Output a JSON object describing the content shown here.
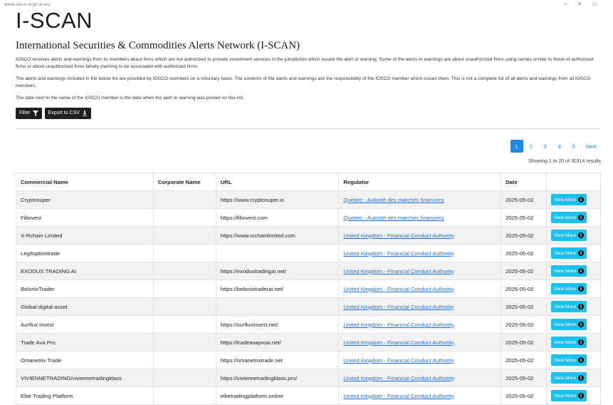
{
  "browser": {
    "url": "www.iosco.org/i-scan/"
  },
  "header": {
    "brand": "I-SCAN",
    "subtitle": "International Securities & Commodities Alerts Network (I-SCAN)"
  },
  "intro": {
    "p1": "IOSCO receives alerts and warnings from its members about firms which are not authorized to provide investment services in the jurisdiction which issued the alert or warning. Some of the alerts or warnings are about unauthorized firms using names similar to those of authorized firms or about unauthorized firms falsely claiming to be associated with authorized firms.",
    "p2": "The alerts and warnings included in the below list are provided by IOSCO members on a voluntary basis. The contents of the alerts and warnings are the responsibility of the IOSCO member which issues them. This is not a complete list of all alerts and warnings from all IOSCO members.",
    "p3": "The date next to the name of the IOSCO member is the date when the alert or warning was posted on this list."
  },
  "toolbar": {
    "filter_label": "Filter",
    "filter_icon": "funnel-icon",
    "export_label": "Export to CSV",
    "export_icon": "download-icon"
  },
  "pagination": {
    "pages": [
      "1",
      "2",
      "3",
      "4",
      "5"
    ],
    "active": "1",
    "next_label": "Next",
    "results_text": "Showing 1 to 20 of 30314 results"
  },
  "table": {
    "headers": [
      "Commercial Name",
      "Corporate Name",
      "URL",
      "Regulator",
      "Date",
      ""
    ],
    "view_more_label": "View More",
    "rows": [
      {
        "name": "Cryptosuper",
        "corp": "",
        "url": "https://www.cryptosuper.io",
        "regulator": "Quebec - Autorité des marchés financiers",
        "date": "2025-05-02"
      },
      {
        "name": "Fibovest",
        "corp": "",
        "url": "https://fibovest.com",
        "regulator": "Quebec - Autorité des marchés financiers",
        "date": "2025-05-02"
      },
      {
        "name": "X-Rchain Limited",
        "corp": "",
        "url": "https://www.xrchainlimited.com",
        "regulator": "United Kingdom - Financial Conduct Authority",
        "date": "2025-05-02"
      },
      {
        "name": "Legitoptiontrade",
        "corp": "",
        "url": "",
        "regulator": "United Kingdom - Financial Conduct Authority",
        "date": "2025-05-02"
      },
      {
        "name": "EXODUS TRADING AI",
        "corp": "",
        "url": "https://exodustradingai.net/",
        "regulator": "United Kingdom - Financial Conduct Authority",
        "date": "2025-05-02"
      },
      {
        "name": "BelonixTrader",
        "corp": "",
        "url": "https://belonixtraderai.net/",
        "regulator": "United Kingdom - Financial Conduct Authority",
        "date": "2025-05-02"
      },
      {
        "name": "Global-digital-asset",
        "corp": "",
        "url": "",
        "regulator": "United Kingdom - Financial Conduct Authority",
        "date": "2025-05-02"
      },
      {
        "name": "Aurflux Invest",
        "corp": "",
        "url": "https://surfluxinvest.net/",
        "regulator": "United Kingdom - Financial Conduct Authority",
        "date": "2025-05-02"
      },
      {
        "name": "Trade Ava Pro",
        "corp": "",
        "url": "https://tradeavaproai.net/",
        "regulator": "United Kingdom - Financial Conduct Authority",
        "date": "2025-05-02"
      },
      {
        "name": "Omanetrix Trade",
        "corp": "",
        "url": "https://omanetrixtrade.net",
        "regulator": "United Kingdom - Financial Conduct Authority",
        "date": "2025-05-02"
      },
      {
        "name": "VIVIENNETRADING/viviennetradingklass",
        "corp": "",
        "url": "https://viviennetradingklass.pro/",
        "regulator": "United Kingdom - Financial Conduct Authority",
        "date": "2025-05-02"
      },
      {
        "name": "Elite Trading Platform",
        "corp": "",
        "url": "elitetradingplatform.online",
        "regulator": "United Kingdom - Financial Conduct Authority",
        "date": "2025-05-02"
      }
    ]
  },
  "colors": {
    "accent": "#1e88e5",
    "view_more": "#19c1ef",
    "link": "#1e6fd9",
    "dark_button": "#1f1f1f"
  }
}
